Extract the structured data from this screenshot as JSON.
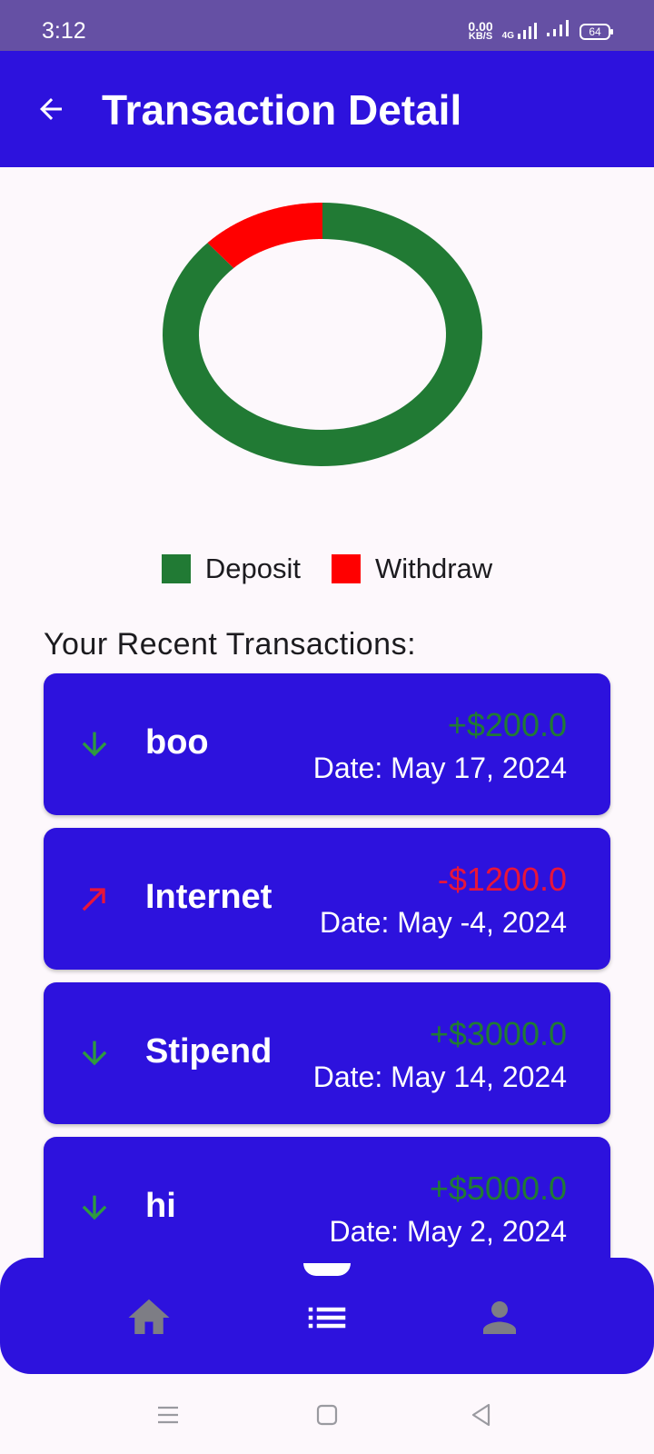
{
  "status_bar": {
    "time": "3:12",
    "net_speed_value": "0.00",
    "net_speed_unit": "KB/S",
    "network_type": "4G",
    "battery": "64"
  },
  "app_bar": {
    "title": "Transaction Detail",
    "back_icon": "arrow-back-icon"
  },
  "chart_data": {
    "type": "pie",
    "style": "donut",
    "categories": [
      "Deposit",
      "Withdraw"
    ],
    "values": [
      8200,
      1200
    ],
    "colors": [
      "#217a34",
      "#ff0000"
    ],
    "legend_position": "bottom"
  },
  "legend": [
    {
      "label": "Deposit",
      "color": "#217a34"
    },
    {
      "label": "Withdraw",
      "color": "#ff0000"
    }
  ],
  "section_title": "Your Recent Transactions:",
  "transactions": [
    {
      "name": "boo",
      "amount": "+$200.0",
      "date": "Date: May 17, 2024",
      "type": "deposit",
      "icon": "arrow-down-icon"
    },
    {
      "name": "Internet",
      "amount": "-$1200.0",
      "date": "Date: May -4, 2024",
      "type": "withdraw",
      "icon": "arrow-up-right-icon"
    },
    {
      "name": "Stipend",
      "amount": "+$3000.0",
      "date": "Date: May 14, 2024",
      "type": "deposit",
      "icon": "arrow-down-icon"
    },
    {
      "name": "hi",
      "amount": "+$5000.0",
      "date": "Date: May 2, 2024",
      "type": "deposit",
      "icon": "arrow-down-icon"
    }
  ],
  "colors": {
    "primary": "#2d12dd",
    "status_bar": "#6550a4",
    "deposit": "#217a34",
    "withdraw": "#ff0000",
    "amount_withdraw_text": "#e8153a",
    "nav_icon": "#7d7d85"
  },
  "bottom_nav": {
    "items": [
      {
        "icon": "home-icon"
      },
      {
        "icon": "list-icon",
        "selected": true
      },
      {
        "icon": "person-icon"
      }
    ]
  },
  "system_nav": {
    "items": [
      {
        "icon": "menu-icon"
      },
      {
        "icon": "home-square-icon"
      },
      {
        "icon": "back-triangle-icon"
      }
    ]
  }
}
